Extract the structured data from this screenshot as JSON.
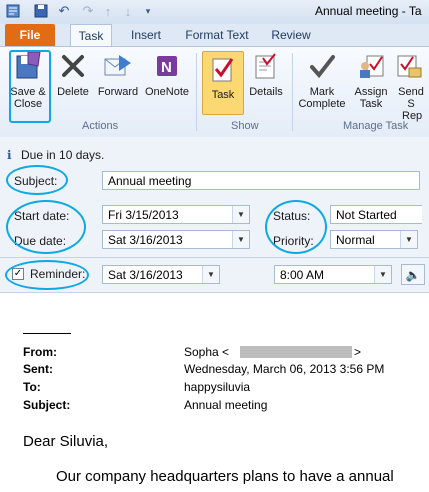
{
  "window": {
    "title": "Annual meeting - Ta"
  },
  "tabs": {
    "file": "File",
    "task": "Task",
    "insert": "Insert",
    "format_text": "Format Text",
    "review": "Review"
  },
  "ribbon": {
    "save_close_line1": "Save &",
    "save_close_line2": "Close",
    "delete": "Delete",
    "forward": "Forward",
    "onenote": "OneNote",
    "task": "Task",
    "details": "Details",
    "mark_complete_line1": "Mark",
    "mark_complete_line2": "Complete",
    "assign_task_line1": "Assign",
    "assign_task_line2": "Task",
    "send_status_line1": "Send S",
    "send_status_line2": "Rep",
    "group_actions": "Actions",
    "group_show": "Show",
    "group_manage": "Manage Task"
  },
  "form": {
    "due_info": "Due in 10 days.",
    "subject_label": "Subject:",
    "subject_value": "Annual meeting",
    "start_label": "Start date:",
    "start_value": "Fri 3/15/2013",
    "due_label": "Due date:",
    "due_value": "Sat 3/16/2013",
    "status_label": "Status:",
    "status_value": "Not Started",
    "priority_label": "Priority:",
    "priority_value": "Normal",
    "reminder_label": "Reminder:",
    "reminder_date": "Sat 3/16/2013",
    "reminder_time": "8:00 AM"
  },
  "message": {
    "from_label": "From:",
    "from_value": "Sopha <",
    "from_end": ">",
    "sent_label": "Sent:",
    "sent_value": "Wednesday, March 06, 2013 3:56 PM",
    "to_label": "To:",
    "to_value": "happysiluvia",
    "subject_label": "Subject:",
    "subject_value": "Annual meeting",
    "greeting": "Dear Siluvia,",
    "line1": "Our company headquarters plans to have a annual"
  },
  "colors": {
    "highlight_ellipse": "#0ea8e4",
    "file_tab": "#e36b13"
  }
}
